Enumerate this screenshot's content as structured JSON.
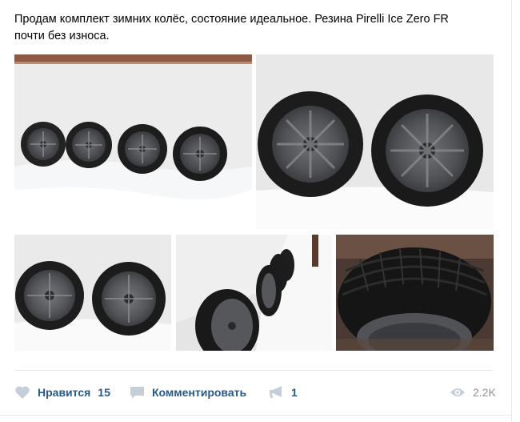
{
  "post": {
    "text_line1": "Продам комплект зимних колёс, состояние идеальное. Резина Pirelli Ice Zero FR",
    "text_line2": "почти без износа."
  },
  "photos": [
    {
      "id": "photo-1"
    },
    {
      "id": "photo-2"
    },
    {
      "id": "photo-3"
    },
    {
      "id": "photo-4"
    },
    {
      "id": "photo-5"
    }
  ],
  "actions": {
    "like_label": "Нравится",
    "like_count": "15",
    "comment_label": "Комментировать",
    "share_count": "1",
    "views_count": "2.2K"
  },
  "colors": {
    "link": "#2a5885",
    "icon": "#c5cfd9",
    "muted": "#939393"
  },
  "icons": [
    "heart-icon",
    "comment-icon",
    "megaphone-icon",
    "eye-icon"
  ]
}
